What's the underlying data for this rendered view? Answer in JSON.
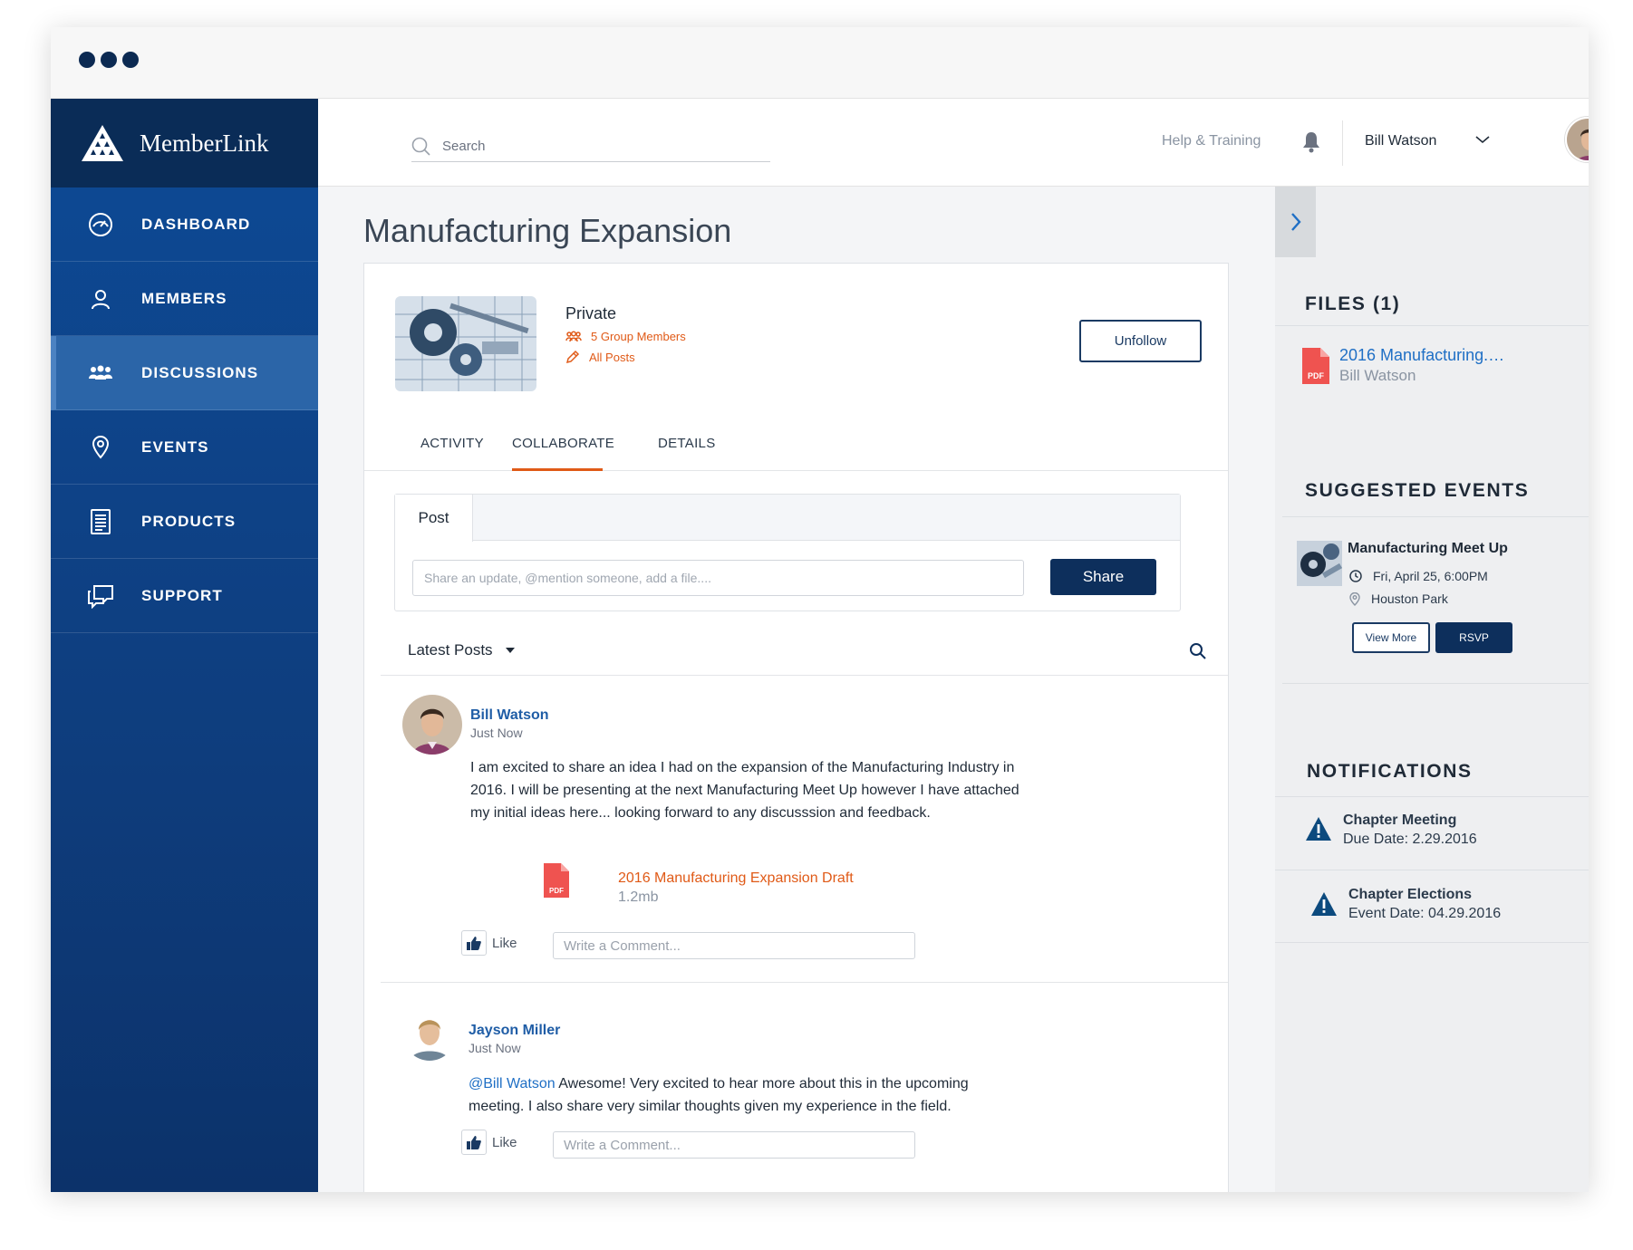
{
  "brand": {
    "name": "MemberLink"
  },
  "search": {
    "placeholder": "Search"
  },
  "topbar": {
    "help_label": "Help & Training",
    "user_name": "Bill Watson"
  },
  "nav": [
    {
      "label": "DASHBOARD",
      "icon": "dashboard-icon"
    },
    {
      "label": "MEMBERS",
      "icon": "person-icon"
    },
    {
      "label": "DISCUSSIONS",
      "icon": "group-icon",
      "active": true
    },
    {
      "label": "EVENTS",
      "icon": "location-pin-icon"
    },
    {
      "label": "PRODUCTS",
      "icon": "document-icon"
    },
    {
      "label": "SUPPORT",
      "icon": "chat-bubbles-icon"
    }
  ],
  "group": {
    "title": "Manufacturing Expansion",
    "privacy": "Private",
    "members_link": "5 Group Members",
    "posts_link": "All Posts",
    "unfollow_label": "Unfollow"
  },
  "tabs": [
    {
      "label": "ACTIVITY"
    },
    {
      "label": "COLLABORATE",
      "active": true
    },
    {
      "label": "DETAILS"
    }
  ],
  "composer": {
    "tab_label": "Post",
    "placeholder": "Share an update, @mention someone, add a file....",
    "share_label": "Share"
  },
  "feed": {
    "sort_label": "Latest Posts",
    "posts": [
      {
        "author": "Bill Watson",
        "time": "Just Now",
        "body": "I am excited to share an idea I had on the expansion of the Manufacturing Industry in 2016. I will be presenting at the next Manufacturing Meet Up however I have attached my initial ideas here... looking forward to any discusssion and feedback.",
        "attachment": {
          "name": "2016 Manufacturing Expansion Draft",
          "size": "1.2mb",
          "type": "PDF"
        },
        "like_label": "Like",
        "comment_placeholder": "Write a Comment..."
      },
      {
        "author": "Jayson Miller",
        "time": "Just Now",
        "mention": "@Bill Watson",
        "body": " Awesome! Very excited to hear more about this in the upcoming meeting. I also share very similar thoughts given my experience in the field.",
        "like_label": "Like",
        "comment_placeholder": "Write a Comment..."
      }
    ]
  },
  "rail": {
    "files_heading": "FILES (1)",
    "file": {
      "name": "2016 Manufacturing.…",
      "owner": "Bill Watson",
      "type": "PDF"
    },
    "events_heading": "SUGGESTED EVENTS",
    "event": {
      "title": "Manufacturing Meet Up",
      "date": "Fri, April 25, 6:00PM",
      "location": "Houston Park",
      "view_more_label": "View More",
      "rsvp_label": "RSVP"
    },
    "notifications_heading": "NOTIFICATIONS",
    "notifications": [
      {
        "title": "Chapter Meeting",
        "date": "Due Date: 2.29.2016"
      },
      {
        "title": "Chapter Elections",
        "date": "Event Date: 04.29.2016"
      }
    ]
  },
  "colors": {
    "primary_navy": "#0d2f5c",
    "sidebar_blue": "#0e3d7d",
    "accent_orange": "#e05a17",
    "link_blue": "#1f6fc5",
    "warning_blue": "#0c4a7e"
  }
}
